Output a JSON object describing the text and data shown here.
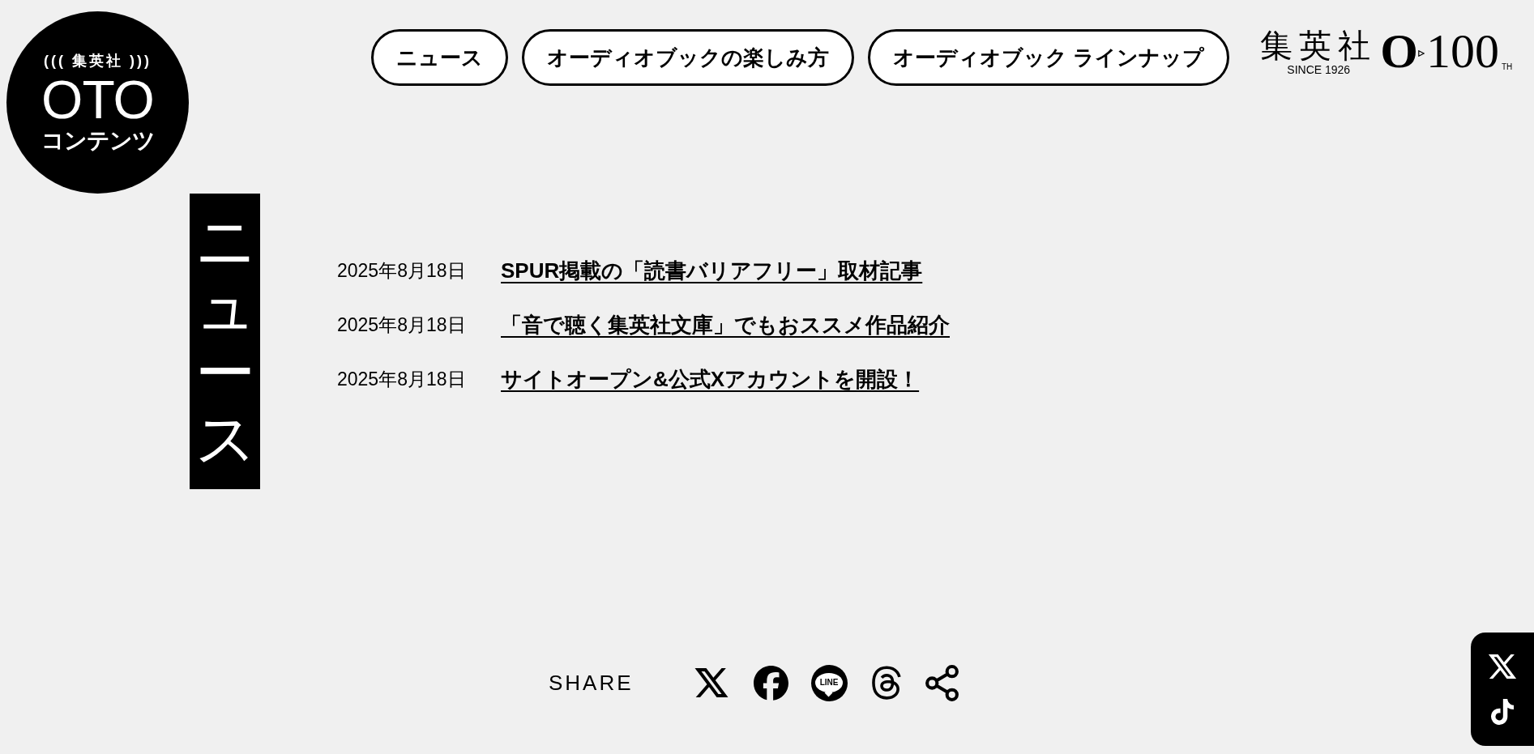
{
  "logo": {
    "publisher": "((( 集英社 )))",
    "title": "OTO",
    "subtitle": "コンテンツ"
  },
  "nav": [
    {
      "label": "ニュース"
    },
    {
      "label": "オーディオブックの楽しみ方"
    },
    {
      "label": "オーディオブック ラインナップ"
    }
  ],
  "brand": {
    "name": "集英社",
    "since": "SINCE 1926",
    "mark_letter": "O",
    "mark_number": "100",
    "suffix": "TH"
  },
  "section_title": "ニュース",
  "news": [
    {
      "date": "2025年8月18日",
      "title": "SPUR掲載の「読書バリアフリー」取材記事"
    },
    {
      "date": "2025年8月18日",
      "title": "「音で聴く集英社文庫」でもおススメ作品紹介"
    },
    {
      "date": "2025年8月18日",
      "title": "サイトオープン&公式Xアカウントを開設！"
    }
  ],
  "share": {
    "label": "SHARE",
    "buttons": [
      {
        "kind": "x"
      },
      {
        "kind": "facebook"
      },
      {
        "kind": "line",
        "label": "LINE"
      },
      {
        "kind": "threads"
      },
      {
        "kind": "share"
      }
    ]
  },
  "floating_links": [
    {
      "kind": "x"
    },
    {
      "kind": "tiktok"
    }
  ]
}
